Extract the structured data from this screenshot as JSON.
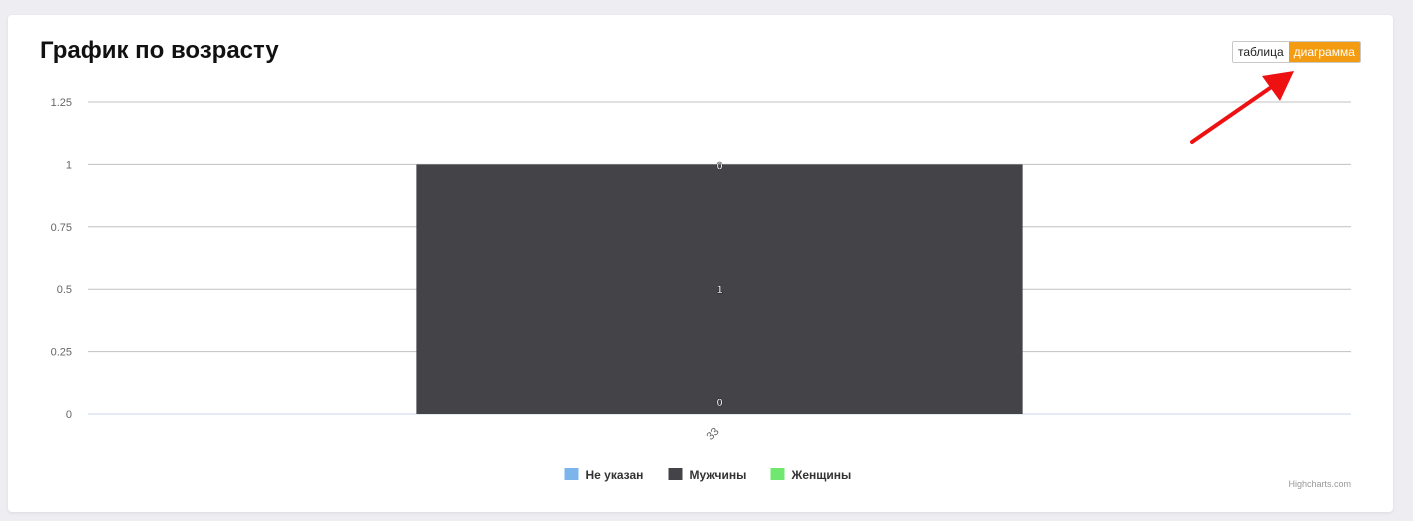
{
  "page": {
    "title": "График по возрасту",
    "toggle": {
      "table_label": "таблица",
      "chart_label": "диаграмма",
      "active": "диаграмма"
    },
    "credits": "Highcharts.com"
  },
  "colors": {
    "accent": "#f39c12",
    "annotation_arrow": "#ee1111"
  },
  "chart_data": {
    "type": "bar",
    "stacked": true,
    "categories": [
      "33"
    ],
    "series": [
      {
        "name": "Не указан",
        "values": [
          0
        ],
        "color": "#7cb5ec"
      },
      {
        "name": "Мужчины",
        "values": [
          1
        ],
        "color": "#434348"
      },
      {
        "name": "Женщины",
        "values": [
          0
        ],
        "color": "#70e870"
      }
    ],
    "data_labels": [
      "0",
      "1",
      "0"
    ],
    "yticks": [
      "0",
      "0.25",
      "0.5",
      "0.75",
      "1",
      "1.25"
    ],
    "ylim": [
      0,
      1.25
    ],
    "grid": true,
    "legend_position": "bottom-center",
    "xlabel": "",
    "ylabel": ""
  }
}
